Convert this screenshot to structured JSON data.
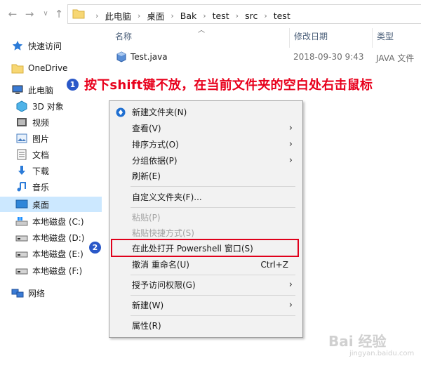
{
  "address": {
    "crumbs": [
      "此电脑",
      "桌面",
      "Bak",
      "test",
      "src",
      "test"
    ]
  },
  "sidebar": {
    "items": [
      {
        "label": "快速访问",
        "icon": "star-icon"
      },
      {
        "label": "OneDrive",
        "icon": "onedrive-folder-icon"
      },
      {
        "label": "此电脑",
        "icon": "computer-icon"
      },
      {
        "label": "3D 对象",
        "icon": "3d-objects-icon"
      },
      {
        "label": "视频",
        "icon": "video-icon"
      },
      {
        "label": "图片",
        "icon": "pictures-icon"
      },
      {
        "label": "文档",
        "icon": "documents-icon"
      },
      {
        "label": "下载",
        "icon": "download-icon"
      },
      {
        "label": "音乐",
        "icon": "music-icon"
      },
      {
        "label": "桌面",
        "icon": "desktop-icon"
      },
      {
        "label": "本地磁盘 (C:)",
        "icon": "drive-icon"
      },
      {
        "label": "本地磁盘 (D:)",
        "icon": "drive-icon"
      },
      {
        "label": "本地磁盘 (E:)",
        "icon": "drive-icon"
      },
      {
        "label": "本地磁盘 (F:)",
        "icon": "drive-icon"
      },
      {
        "label": "网络",
        "icon": "network-icon"
      }
    ]
  },
  "columns": {
    "name": "名称",
    "date": "修改日期",
    "type": "类型"
  },
  "files": [
    {
      "name": "Test.java",
      "date": "2018-09-30 9:43",
      "type": "JAVA 文件"
    }
  ],
  "annotation": {
    "step1_number": "1",
    "step1_text": "按下shift键不放，在当前文件夹的空白处右击鼠标",
    "step2_number": "2"
  },
  "menu": {
    "items": [
      {
        "label": "新建文件夹(N)",
        "shortcut": "",
        "submenu": false,
        "disabled": false
      },
      {
        "label": "查看(V)",
        "shortcut": "",
        "submenu": true,
        "disabled": false
      },
      {
        "label": "排序方式(O)",
        "shortcut": "",
        "submenu": true,
        "disabled": false
      },
      {
        "label": "分组依据(P)",
        "shortcut": "",
        "submenu": true,
        "disabled": false
      },
      {
        "label": "刷新(E)",
        "shortcut": "",
        "submenu": false,
        "disabled": false
      },
      {
        "label": "自定义文件夹(F)...",
        "shortcut": "",
        "submenu": false,
        "disabled": false
      },
      {
        "label": "粘贴(P)",
        "shortcut": "",
        "submenu": false,
        "disabled": true
      },
      {
        "label": "粘贴快捷方式(S)",
        "shortcut": "",
        "submenu": false,
        "disabled": true
      },
      {
        "label": "在此处打开 Powershell 窗口(S)",
        "shortcut": "",
        "submenu": false,
        "disabled": false
      },
      {
        "label": "撤消 重命名(U)",
        "shortcut": "Ctrl+Z",
        "submenu": false,
        "disabled": false
      },
      {
        "label": "授予访问权限(G)",
        "shortcut": "",
        "submenu": true,
        "disabled": false
      },
      {
        "label": "新建(W)",
        "shortcut": "",
        "submenu": true,
        "disabled": false
      },
      {
        "label": "属性(R)",
        "shortcut": "",
        "submenu": false,
        "disabled": false
      }
    ]
  },
  "watermark": {
    "main": "Bai 经验",
    "sub": "jingyan.baidu.com"
  },
  "colors": {
    "annotation_red": "#e8001c",
    "badge_blue": "#2a58c8",
    "selection": "#cce8ff"
  }
}
